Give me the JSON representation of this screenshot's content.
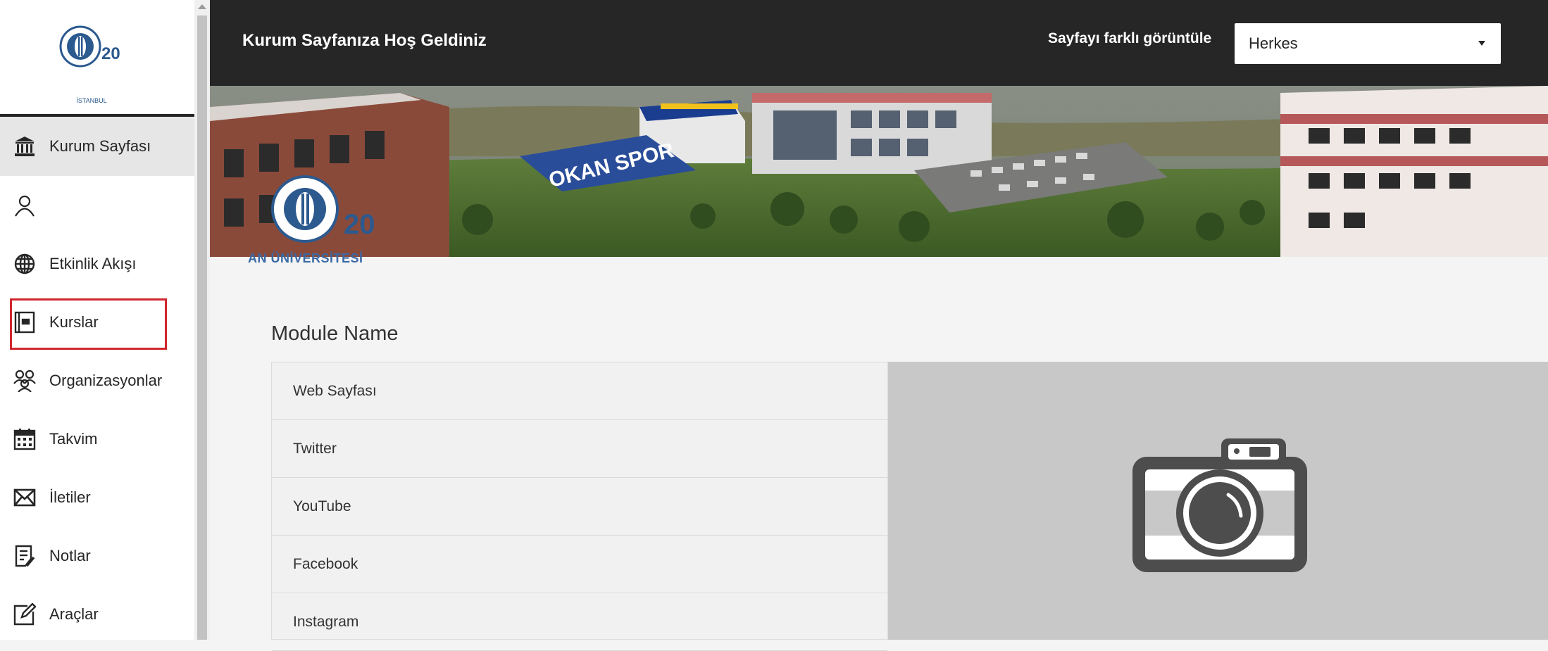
{
  "sidebar": {
    "logo_text": "OKAN ÜNİVERSİTESİ",
    "logo_small": "İSTANBUL",
    "items": [
      {
        "label": "Kurum Sayfası",
        "icon": "institution-icon"
      },
      {
        "label": "",
        "icon": "user-icon"
      },
      {
        "label": "Etkinlik Akışı",
        "icon": "globe-icon"
      },
      {
        "label": "Kurslar",
        "icon": "courses-icon"
      },
      {
        "label": "Organizasyonlar",
        "icon": "organizations-icon"
      },
      {
        "label": "Takvim",
        "icon": "calendar-icon"
      },
      {
        "label": "İletiler",
        "icon": "envelope-icon"
      },
      {
        "label": "Notlar",
        "icon": "grades-icon"
      },
      {
        "label": "Araçlar",
        "icon": "tools-icon"
      }
    ]
  },
  "header": {
    "title": "Kurum Sayfanıza Hoş Geldiniz",
    "view_label": "Sayfayı farklı görüntüle",
    "view_value": "Herkes"
  },
  "banner": {
    "sign_text": "OKAN SPOR",
    "logo_text": "AN ÜNİVERSİTESİ"
  },
  "module": {
    "title": "Module Name",
    "links": [
      "Web Sayfası",
      "Twitter",
      "YouTube",
      "Facebook",
      "Instagram"
    ]
  },
  "colors": {
    "header_bg": "#262626",
    "highlight_border": "#d0262d",
    "active_bg": "#e6e6e6",
    "image_panel_bg": "#c8c8c8"
  }
}
